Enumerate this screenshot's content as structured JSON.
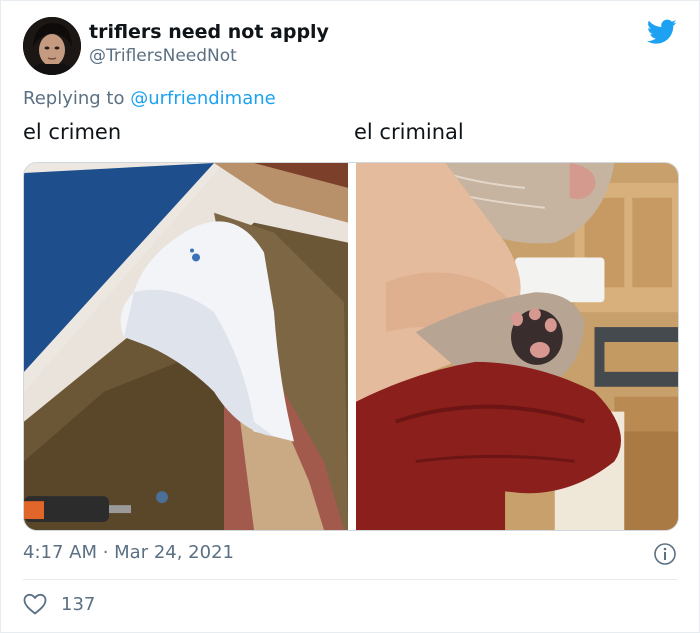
{
  "author": {
    "display_name": "triflers need not apply",
    "handle": "@TriflersNeedNot"
  },
  "reply": {
    "prefix": "Replying to ",
    "to_handle": "@urfriendimane"
  },
  "captions": {
    "left": "el crimen",
    "right": "el criminal"
  },
  "meta": {
    "timestamp": "4:17 AM · Mar 24, 2021"
  },
  "engagement": {
    "likes": "137"
  },
  "icons": {
    "brand": "twitter-bird-icon",
    "info": "info-icon",
    "like": "heart-icon"
  },
  "colors": {
    "brand_blue": "#1da1f2",
    "secondary_text": "#5b7083",
    "primary_text": "#0f1419"
  }
}
